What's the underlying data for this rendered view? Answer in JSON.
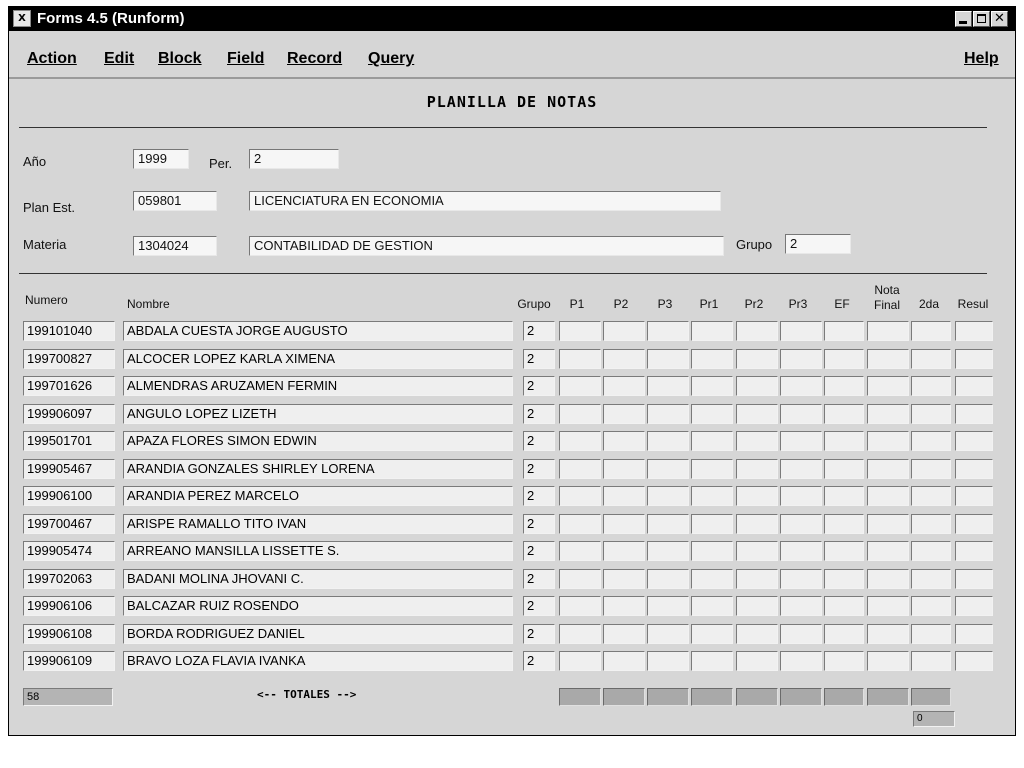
{
  "window": {
    "title": "Forms 4.5 (Runform)",
    "app_icon_text": "X"
  },
  "menu": {
    "items": [
      "Action",
      "Edit",
      "Block",
      "Field",
      "Record",
      "Query"
    ],
    "help": "Help"
  },
  "form": {
    "title": "PLANILLA DE NOTAS",
    "anio_label": "Año",
    "anio_value": "1999",
    "per_label": "Per.",
    "per_value": "2",
    "plan_label": "Plan Est.",
    "plan_code": "059801",
    "plan_name": "LICENCIATURA EN ECONOMIA",
    "materia_label": "Materia",
    "materia_code": "1304024",
    "materia_name": "CONTABILIDAD DE GESTION",
    "grupo_label": "Grupo",
    "grupo_value": "2"
  },
  "table": {
    "headers": {
      "numero": "Numero",
      "nombre": "Nombre",
      "grupo": "Grupo",
      "p1": "P1",
      "p2": "P2",
      "p3": "P3",
      "pr1": "Pr1",
      "pr2": "Pr2",
      "pr3": "Pr3",
      "ef": "EF",
      "nota": "Nota",
      "final": "Final",
      "segunda": "2da",
      "resul": "Resul"
    },
    "rows": [
      {
        "numero": "199101040",
        "nombre": "ABDALA CUESTA JORGE AUGUSTO",
        "grupo": "2"
      },
      {
        "numero": "199700827",
        "nombre": "ALCOCER LOPEZ KARLA XIMENA",
        "grupo": "2"
      },
      {
        "numero": "199701626",
        "nombre": "ALMENDRAS ARUZAMEN FERMIN",
        "grupo": "2"
      },
      {
        "numero": "199906097",
        "nombre": "ANGULO LOPEZ LIZETH",
        "grupo": "2"
      },
      {
        "numero": "199501701",
        "nombre": "APAZA FLORES SIMON EDWIN",
        "grupo": "2"
      },
      {
        "numero": "199905467",
        "nombre": "ARANDIA GONZALES SHIRLEY LORENA",
        "grupo": "2"
      },
      {
        "numero": "199906100",
        "nombre": "ARANDIA PEREZ MARCELO",
        "grupo": "2"
      },
      {
        "numero": "199700467",
        "nombre": "ARISPE RAMALLO TITO IVAN",
        "grupo": "2"
      },
      {
        "numero": "199905474",
        "nombre": "ARREANO MANSILLA LISSETTE S.",
        "grupo": "2"
      },
      {
        "numero": "199702063",
        "nombre": "BADANI MOLINA JHOVANI C.",
        "grupo": "2"
      },
      {
        "numero": "199906106",
        "nombre": "BALCAZAR RUIZ ROSENDO",
        "grupo": "2"
      },
      {
        "numero": "199906108",
        "nombre": "BORDA RODRIGUEZ DANIEL",
        "grupo": "2"
      },
      {
        "numero": "199906109",
        "nombre": "BRAVO LOZA FLAVIA IVANKA",
        "grupo": "2"
      }
    ]
  },
  "footer": {
    "count": "58",
    "totales": "<-- TOTALES -->",
    "total_value": "0"
  }
}
